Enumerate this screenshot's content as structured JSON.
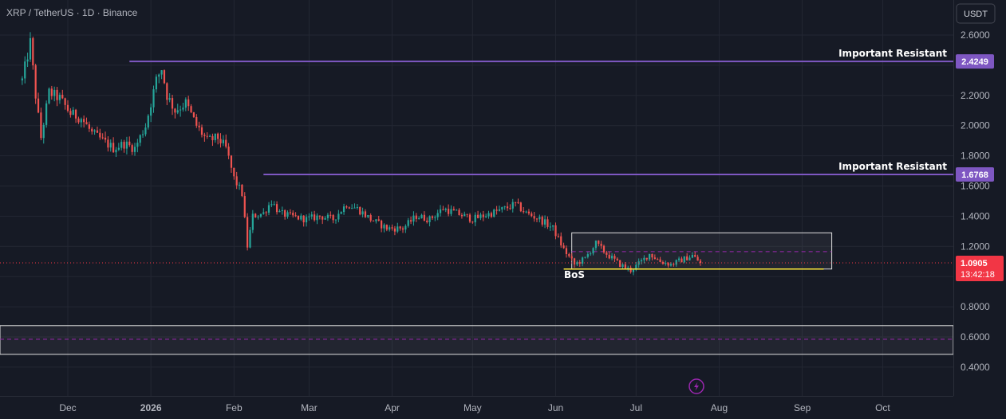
{
  "header": {
    "title": "XRP / TetherUS · 1D · Binance",
    "currency_button": "USDT"
  },
  "chart_data": {
    "type": "candlestick",
    "title": "XRP / TetherUS · 1D · Binance",
    "xlabel": "",
    "ylabel": "",
    "ylim": [
      0.26,
      2.76
    ],
    "x_ticks": [
      "Dec",
      "2026",
      "Feb",
      "Mar",
      "Apr",
      "May",
      "Jun",
      "Jul",
      "Aug",
      "Sep",
      "Oct"
    ],
    "y_ticks": [
      "0.4000",
      "0.6000",
      "0.8000",
      "1.0000",
      "1.2000",
      "1.4000",
      "1.6000",
      "1.8000",
      "2.0000",
      "2.2000",
      "2.4000",
      "2.6000"
    ],
    "y_tick_values": [
      0.4,
      0.6,
      0.8,
      1.0,
      1.2,
      1.4,
      1.6,
      1.8,
      2.0,
      2.2,
      2.4,
      2.6
    ],
    "grid": true,
    "up_color": "#26a69a",
    "down_color": "#ef5350",
    "last_price": {
      "value": 1.0905,
      "label": "1.0905",
      "countdown": "13:42:18",
      "color": "#f23645"
    },
    "price_path": [
      [
        "2025-11-14",
        2.3
      ],
      [
        "2025-11-17",
        2.55
      ],
      [
        "2025-11-19",
        2.2
      ],
      [
        "2025-11-21",
        1.92
      ],
      [
        "2025-11-24",
        2.22
      ],
      [
        "2025-11-28",
        2.18
      ],
      [
        "2025-12-02",
        2.08
      ],
      [
        "2025-12-06",
        2.05
      ],
      [
        "2025-12-10",
        1.95
      ],
      [
        "2025-12-14",
        1.9
      ],
      [
        "2025-12-18",
        1.85
      ],
      [
        "2025-12-22",
        1.88
      ],
      [
        "2025-12-26",
        1.85
      ],
      [
        "2025-12-30",
        2.0
      ],
      [
        "2026-01-03",
        2.3
      ],
      [
        "2026-01-05",
        2.38
      ],
      [
        "2026-01-07",
        2.2
      ],
      [
        "2026-01-10",
        2.1
      ],
      [
        "2026-01-14",
        2.15
      ],
      [
        "2026-01-18",
        2.0
      ],
      [
        "2026-01-22",
        1.9
      ],
      [
        "2026-01-26",
        1.92
      ],
      [
        "2026-01-29",
        1.85
      ],
      [
        "2026-02-01",
        1.65
      ],
      [
        "2026-02-04",
        1.55
      ],
      [
        "2026-02-06",
        1.2
      ],
      [
        "2026-02-08",
        1.4
      ],
      [
        "2026-02-12",
        1.42
      ],
      [
        "2026-02-15",
        1.5
      ],
      [
        "2026-02-18",
        1.42
      ],
      [
        "2026-02-22",
        1.4
      ],
      [
        "2026-02-28",
        1.38
      ],
      [
        "2026-03-05",
        1.4
      ],
      [
        "2026-03-10",
        1.38
      ],
      [
        "2026-03-15",
        1.48
      ],
      [
        "2026-03-19",
        1.45
      ],
      [
        "2026-03-24",
        1.38
      ],
      [
        "2026-03-30",
        1.32
      ],
      [
        "2026-04-05",
        1.32
      ],
      [
        "2026-04-10",
        1.4
      ],
      [
        "2026-04-15",
        1.38
      ],
      [
        "2026-04-20",
        1.45
      ],
      [
        "2026-04-25",
        1.42
      ],
      [
        "2026-05-01",
        1.38
      ],
      [
        "2026-05-08",
        1.42
      ],
      [
        "2026-05-13",
        1.45
      ],
      [
        "2026-05-17",
        1.48
      ],
      [
        "2026-05-21",
        1.42
      ],
      [
        "2026-05-26",
        1.38
      ],
      [
        "2026-05-31",
        1.32
      ],
      [
        "2026-06-04",
        1.18
      ],
      [
        "2026-06-08",
        1.08
      ],
      [
        "2026-06-12",
        1.12
      ],
      [
        "2026-06-16",
        1.22
      ],
      [
        "2026-06-20",
        1.15
      ],
      [
        "2026-06-25",
        1.08
      ],
      [
        "2026-06-29",
        1.04
      ],
      [
        "2026-07-03",
        1.1
      ],
      [
        "2026-07-06",
        1.15
      ],
      [
        "2026-07-10",
        1.1
      ],
      [
        "2026-07-14",
        1.08
      ],
      [
        "2026-07-18",
        1.11
      ],
      [
        "2026-07-22",
        1.14
      ],
      [
        "2026-07-25",
        1.09
      ]
    ],
    "volatility": 0.035,
    "horizontal_levels": [
      {
        "label": "Important Resistant",
        "value": 2.4249,
        "tag": "2.4249",
        "start": "2025-12-24",
        "color": "#7e57c2"
      },
      {
        "label": "Important Resistant",
        "value": 1.6768,
        "tag": "1.6768",
        "start": "2026-02-12",
        "color": "#7e57c2"
      }
    ],
    "zones": [
      {
        "x_start": "2026-06-07",
        "x_end": "2026-09-12",
        "top": 1.29,
        "bottom": 1.05,
        "mid": 1.165
      },
      {
        "x_start": "2025-11-01",
        "x_end": "2026-12-31",
        "top": 0.675,
        "bottom": 0.485,
        "mid": 0.585
      }
    ],
    "support_line": {
      "value": 1.05,
      "start": "2026-06-04",
      "end": "2026-09-09",
      "color": "#ffeb3b"
    },
    "annotations": [
      {
        "text": "BoS",
        "date": "2026-06-08",
        "value": 0.99
      }
    ]
  },
  "colors": {
    "background": "#161a25",
    "grid": "#232733",
    "text": "#b2b5be",
    "resistance": "#7e57c2",
    "support": "#ffeb3b",
    "zone_border": "#e0e0e0",
    "zone_mid": "#9c27b0",
    "last_price": "#f23645",
    "alert": "#9c27b0"
  },
  "icons": {
    "alert_icon": "lightning-bolt-icon"
  }
}
